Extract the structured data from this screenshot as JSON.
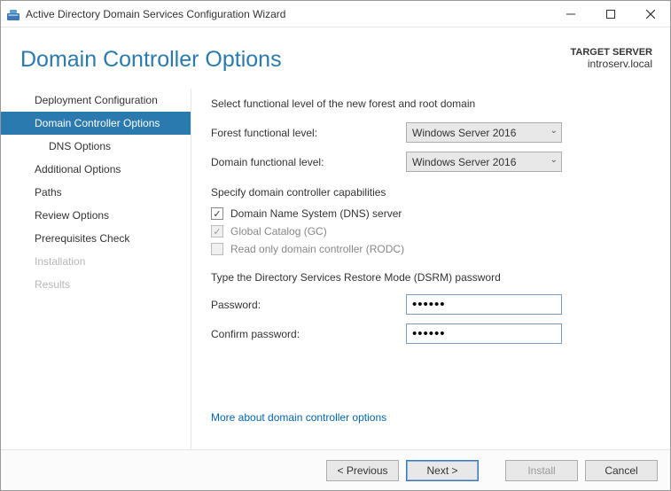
{
  "window": {
    "title": "Active Directory Domain Services Configuration Wizard"
  },
  "header": {
    "page_title": "Domain Controller Options",
    "target_label": "TARGET SERVER",
    "target_value": "introserv.local"
  },
  "sidebar": {
    "items": [
      {
        "label": "Deployment Configuration",
        "state": "normal",
        "lvl": 1
      },
      {
        "label": "Domain Controller Options",
        "state": "selected",
        "lvl": 1
      },
      {
        "label": "DNS Options",
        "state": "normal",
        "lvl": 2
      },
      {
        "label": "Additional Options",
        "state": "normal",
        "lvl": 1
      },
      {
        "label": "Paths",
        "state": "normal",
        "lvl": 1
      },
      {
        "label": "Review Options",
        "state": "normal",
        "lvl": 1
      },
      {
        "label": "Prerequisites Check",
        "state": "normal",
        "lvl": 1
      },
      {
        "label": "Installation",
        "state": "disabled",
        "lvl": 1
      },
      {
        "label": "Results",
        "state": "disabled",
        "lvl": 1
      }
    ]
  },
  "content": {
    "functional_intro": "Select functional level of the new forest and root domain",
    "forest_label": "Forest functional level:",
    "forest_value": "Windows Server 2016",
    "domain_label": "Domain functional level:",
    "domain_value": "Windows Server 2016",
    "capabilities_label": "Specify domain controller capabilities",
    "cb_dns": "Domain Name System (DNS) server",
    "cb_gc": "Global Catalog (GC)",
    "cb_rodc": "Read only domain controller (RODC)",
    "dsrm_label": "Type the Directory Services Restore Mode (DSRM) password",
    "pw_label": "Password:",
    "pw_value": "••••••",
    "cpw_label": "Confirm password:",
    "cpw_value": "••••••",
    "more_link": "More about domain controller options"
  },
  "footer": {
    "previous": "< Previous",
    "next": "Next >",
    "install": "Install",
    "cancel": "Cancel"
  }
}
